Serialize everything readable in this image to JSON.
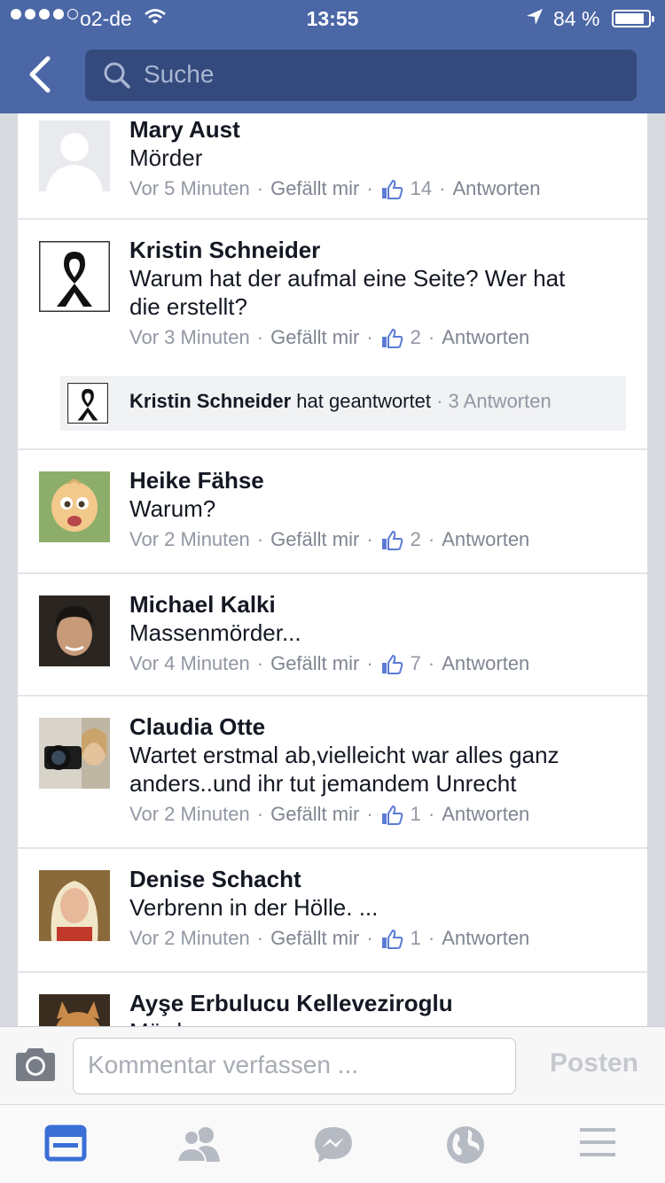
{
  "status_bar": {
    "carrier": "o2-de",
    "time": "13:55",
    "battery": "84 %"
  },
  "header": {
    "search_placeholder": "Suche"
  },
  "comments": [
    {
      "name": "Mary Aust",
      "text": [
        "Mörder"
      ],
      "time": "Vor 5 Minuten",
      "like_label": "Gefällt mir",
      "likes": "14",
      "reply_label": "Antworten"
    },
    {
      "name": "Kristin Schneider",
      "text": [
        "Warum hat der aufmal eine Seite? Wer hat",
        "die erstellt?"
      ],
      "time": "Vor 3 Minuten",
      "like_label": "Gefällt mir",
      "likes": "2",
      "reply_label": "Antworten",
      "reply": {
        "name": "Kristin Schneider",
        "action": "hat geantwortet",
        "count": "3 Antworten"
      }
    },
    {
      "name": "Heike Fähse",
      "text": [
        "Warum?"
      ],
      "time": "Vor 2 Minuten",
      "like_label": "Gefällt mir",
      "likes": "2",
      "reply_label": "Antworten"
    },
    {
      "name": "Michael Kalki",
      "text": [
        "Massenmörder..."
      ],
      "time": "Vor 4 Minuten",
      "like_label": "Gefällt mir",
      "likes": "7",
      "reply_label": "Antworten"
    },
    {
      "name": "Claudia Otte",
      "text": [
        "Wartet erstmal ab,vielleicht war alles ganz",
        "anders..und ihr tut jemandem Unrecht"
      ],
      "time": "Vor 2 Minuten",
      "like_label": "Gefällt mir",
      "likes": "1",
      "reply_label": "Antworten"
    },
    {
      "name": "Denise Schacht",
      "text": [
        "Verbrenn in der Hölle. ..."
      ],
      "time": "Vor 2 Minuten",
      "like_label": "Gefällt mir",
      "likes": "1",
      "reply_label": "Antworten"
    },
    {
      "name": "Ayşe Erbulucu Kelleveziroglu",
      "text": [
        "Mörder"
      ]
    }
  ],
  "composer": {
    "placeholder": "Kommentar verfassen ...",
    "post_label": "Posten"
  },
  "tabbar": {
    "tabs": [
      "news-feed-icon",
      "friends-icon",
      "messenger-icon",
      "globe-icon",
      "menu-icon"
    ],
    "active_color": "#3b6fd6",
    "inactive_color": "#b6bac2"
  },
  "colors": {
    "header_bg": "#4b67a6",
    "search_bg": "#344a7d"
  }
}
